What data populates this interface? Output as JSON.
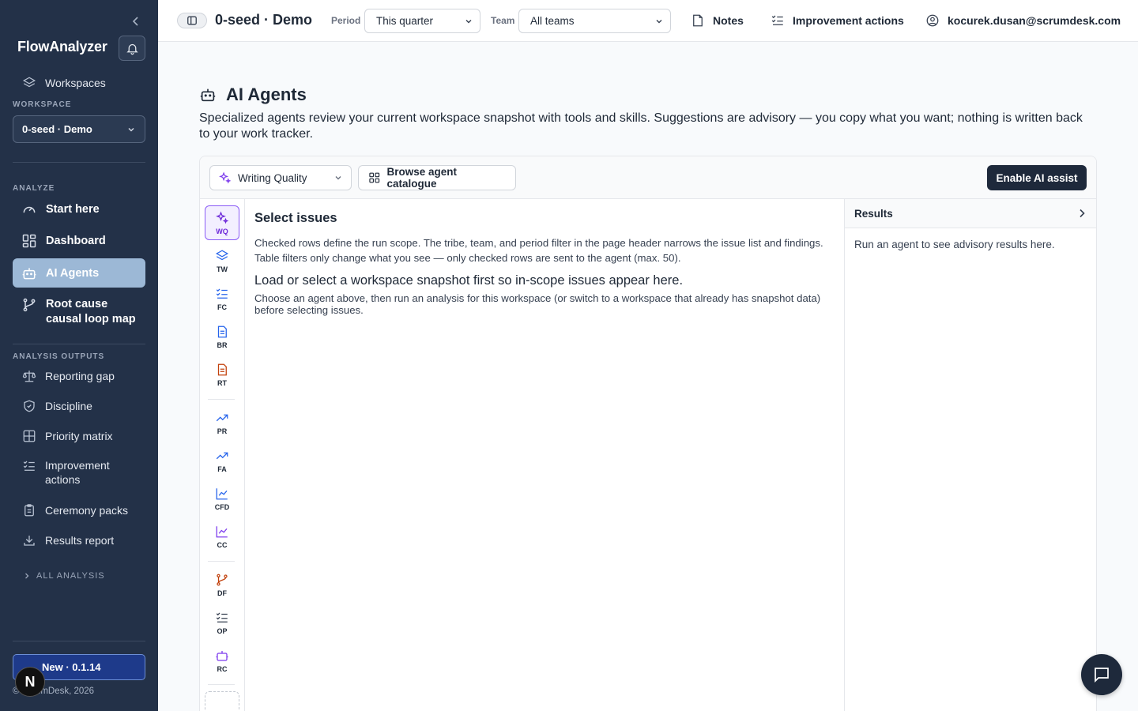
{
  "sidebar": {
    "brand": "FlowAnalyzer",
    "workspaces_label": "Workspaces",
    "workspace_section": "WORKSPACE",
    "workspace_value": "0-seed · Demo",
    "analyze_section": "ANALYZE",
    "analyze_items": [
      {
        "label": "Start here",
        "icon": "gauge-icon"
      },
      {
        "label": "Dashboard",
        "icon": "dashboard-icon"
      },
      {
        "label": "AI Agents",
        "icon": "bot-icon",
        "active": true
      },
      {
        "label": "Root cause causal loop map",
        "icon": "branch-icon"
      }
    ],
    "outputs_section": "ANALYSIS OUTPUTS",
    "output_items": [
      {
        "label": "Reporting gap",
        "icon": "scale-icon"
      },
      {
        "label": "Discipline",
        "icon": "shield-icon"
      },
      {
        "label": "Priority matrix",
        "icon": "grid-icon"
      },
      {
        "label": "Improvement actions",
        "icon": "list-check-icon"
      },
      {
        "label": "Ceremony packs",
        "icon": "clipboard-icon"
      },
      {
        "label": "Results report",
        "icon": "download-icon"
      }
    ],
    "all_analysis": "ALL ANALYSIS",
    "version": "New · 0.1.14",
    "footer": "© ScrumDesk, 2026",
    "n_badge": "N"
  },
  "header": {
    "workspace_title": "0-seed · Demo",
    "period_label": "Period",
    "period_value": "This quarter",
    "team_label": "Team",
    "team_value": "All teams",
    "notes": "Notes",
    "improvement_actions": "Improvement actions",
    "user": "kocurek.dusan@scrumdesk.com"
  },
  "main": {
    "title": "AI Agents",
    "description": "Specialized agents review your current workspace snapshot with tools and skills. Suggestions are advisory — you copy what you want; nothing is written back to your work tracker.",
    "agent_select": "Writing Quality",
    "browse": "Browse agent catalogue",
    "enable": "Enable AI assist",
    "rail": [
      {
        "code": "WQ",
        "icon": "sparkles-icon",
        "active": true
      },
      {
        "code": "TW",
        "icon": "layers-icon"
      },
      {
        "code": "FC",
        "icon": "list-check-icon"
      },
      {
        "code": "BR",
        "icon": "document-icon"
      },
      {
        "code": "RT",
        "icon": "document-icon"
      },
      {
        "code": "PR",
        "icon": "trend-up-icon"
      },
      {
        "code": "FA",
        "icon": "trend-up-icon"
      },
      {
        "code": "CFD",
        "icon": "line-chart-icon"
      },
      {
        "code": "CC",
        "icon": "line-chart-icon"
      },
      {
        "code": "DF",
        "icon": "branch-icon"
      },
      {
        "code": "OP",
        "icon": "list-check-icon"
      },
      {
        "code": "RC",
        "icon": "bot-icon"
      }
    ],
    "issues_title": "Select issues",
    "issues_help": "Checked rows define the run scope. The tribe, team, and period filter in the page header narrows the issue list and findings. Table filters only change what you see — only checked rows are sent to the agent (max. 50).",
    "empty_title": "Load or select a workspace snapshot first so in-scope issues appear here.",
    "empty_desc": "Choose an agent above, then run an analysis for this workspace (or switch to a workspace that already has snapshot data) before selecting issues.",
    "results_title": "Results",
    "results_empty": "Run an agent to see advisory results here."
  },
  "colors": {
    "sidebar_bg": "#233148",
    "active_nav": "#9cb8d6",
    "accent_purple": "#8b5cf6",
    "primary_dark": "#1e293b"
  }
}
